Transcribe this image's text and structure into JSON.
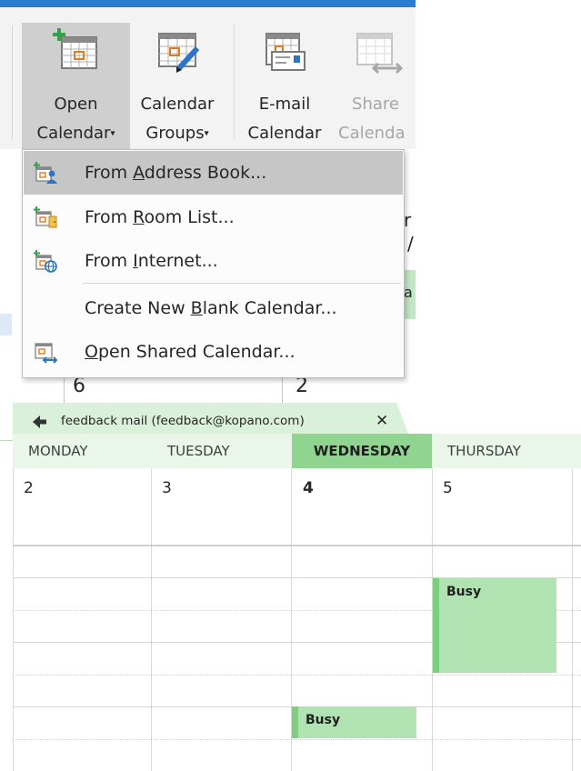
{
  "ribbon": {
    "buttons": [
      {
        "line1": "Open",
        "line2": "Calendar",
        "caret": "▾",
        "icon": "open-calendar-icon",
        "state": "selected"
      },
      {
        "line1": "Calendar",
        "line2": "Groups",
        "caret": "▾",
        "icon": "calendar-groups-icon"
      },
      {
        "line1": "E-mail",
        "line2": "Calendar",
        "icon": "email-calendar-icon"
      },
      {
        "line1": "Share",
        "line2": "Calenda",
        "icon": "share-calendar-icon",
        "state": "disabled"
      }
    ]
  },
  "background_fragments": {
    "day_6": "6",
    "day_2": "2",
    "frag_a": "a",
    "frag_r": "r",
    "frag_slash": "/"
  },
  "menu": {
    "items": [
      {
        "pre": "From ",
        "accel": "A",
        "post": "ddress Book...",
        "icon": "address-book-icon",
        "highlighted": true
      },
      {
        "pre": "From ",
        "accel": "R",
        "post": "oom List...",
        "icon": "room-list-icon"
      },
      {
        "pre": "From ",
        "accel": "I",
        "post": "nternet...",
        "icon": "internet-calendar-icon"
      },
      {
        "pre": "Create New ",
        "accel": "B",
        "post": "lank Calendar..."
      },
      {
        "pre": "",
        "accel": "O",
        "post": "pen Shared Calendar...",
        "icon": "shared-calendar-icon"
      }
    ]
  },
  "calendar": {
    "tab": {
      "title": "feedback mail (feedback@kopano.com)",
      "close": "✕"
    },
    "days": [
      {
        "name": "MONDAY",
        "date": "2"
      },
      {
        "name": "TUESDAY",
        "date": "3"
      },
      {
        "name": "WEDNESDAY",
        "date": "4",
        "today": true
      },
      {
        "name": "THURSDAY",
        "date": "5"
      }
    ],
    "appointments": [
      {
        "day": "THURSDAY",
        "label": "Busy"
      },
      {
        "day": "WEDNESDAY",
        "label": "Busy"
      }
    ]
  },
  "colors": {
    "ribbon_accent": "#2b7bcf",
    "today_header": "#8fd48f",
    "appointment": "#b1e2b1",
    "appointment_bar": "#7ccf7c"
  }
}
